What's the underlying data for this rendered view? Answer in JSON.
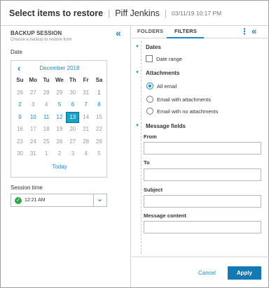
{
  "header": {
    "title": "Select items to restore",
    "separator": "|",
    "user": "Piff Jenkins",
    "date": "03/11/19 10:17 PM"
  },
  "left": {
    "section_title": "BACKUP SESSION",
    "section_subtitle": "Choose a backup to restore from",
    "collapse_icon": "double-chevron-left-icon",
    "date_label": "Date",
    "calendar": {
      "month": "December 2018",
      "prev_icon": "chevron-left-icon",
      "weekdays": [
        "Su",
        "Mo",
        "Tu",
        "We",
        "Th",
        "Fr",
        "Sa"
      ],
      "weeks": [
        [
          "26",
          "27",
          "28",
          "29",
          "30",
          "31",
          "1"
        ],
        [
          "2",
          "3",
          "4",
          "5",
          "6",
          "7",
          "8"
        ],
        [
          "9",
          "10",
          "11",
          "12",
          "13",
          "14",
          "15"
        ],
        [
          "16",
          "17",
          "18",
          "19",
          "20",
          "21",
          "22"
        ],
        [
          "23",
          "24",
          "25",
          "26",
          "27",
          "28",
          "29"
        ],
        [
          "30",
          "31",
          "1",
          "2",
          "3",
          "4",
          "5"
        ]
      ],
      "available": [
        [
          0,
          6
        ],
        [
          1,
          0
        ],
        [
          1,
          3
        ],
        [
          1,
          4
        ],
        [
          1,
          5
        ],
        [
          1,
          6
        ],
        [
          2,
          0
        ],
        [
          2,
          1
        ],
        [
          2,
          2
        ],
        [
          2,
          3
        ],
        [
          2,
          4
        ]
      ],
      "selected": [
        2,
        4
      ],
      "today_label": "Today"
    },
    "session_time_label": "Session time",
    "session_time_value": "12:21 AM",
    "session_status_icon": "check-circle-icon",
    "dropdown_icon": "chevron-down-icon"
  },
  "right": {
    "tabs": [
      "FOLDERS",
      "FILTERS"
    ],
    "active_tab": "FILTERS",
    "more_icon": "kebab-menu-icon",
    "collapse_icon": "double-chevron-right-icon",
    "dates": {
      "title": "Dates",
      "checkbox_label": "Date range"
    },
    "attachments": {
      "title": "Attachments",
      "options": [
        "All email",
        "Email with attachments",
        "Email with no attachments"
      ],
      "selected_index": 0
    },
    "message_fields": {
      "title": "Message fields",
      "fields": [
        "From",
        "To",
        "Subject",
        "Message content"
      ]
    },
    "footer": {
      "cancel": "Cancel",
      "apply": "Apply"
    }
  },
  "colors": {
    "accent": "#1e88c8",
    "selected_day": "#17a2c9",
    "apply_button": "#1478b4",
    "status_ok": "#2ea84a"
  }
}
